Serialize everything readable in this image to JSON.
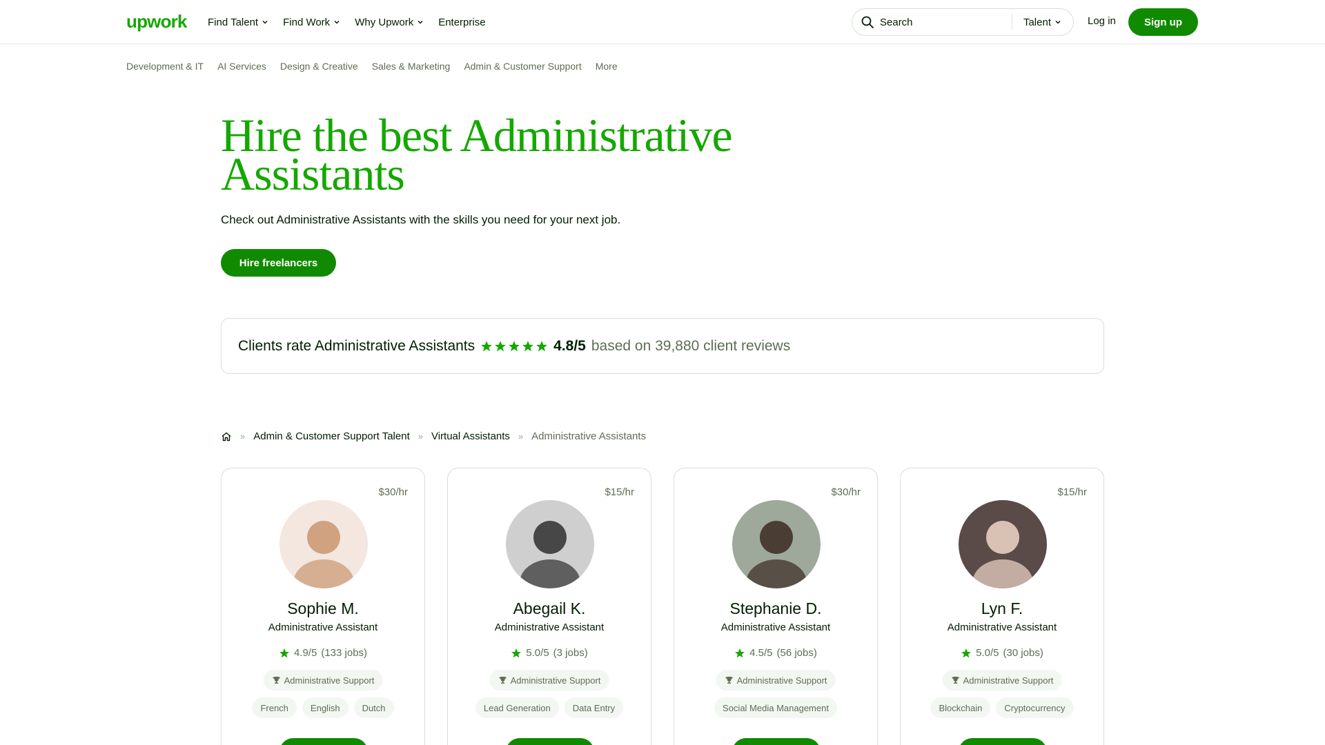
{
  "header": {
    "logo": "upwork",
    "nav": [
      {
        "label": "Find Talent",
        "dropdown": true
      },
      {
        "label": "Find Work",
        "dropdown": true
      },
      {
        "label": "Why Upwork",
        "dropdown": true
      },
      {
        "label": "Enterprise",
        "dropdown": false
      }
    ],
    "search": {
      "placeholder": "Search",
      "scope": "Talent"
    },
    "login": "Log in",
    "signup": "Sign up"
  },
  "subnav": [
    "Development & IT",
    "AI Services",
    "Design & Creative",
    "Sales & Marketing",
    "Admin & Customer Support",
    "More"
  ],
  "hero": {
    "title_line1": "Hire the best Administrative",
    "title_line2": "Assistants",
    "subtitle": "Check out Administrative Assistants with the skills you need for your next job.",
    "cta": "Hire freelancers"
  },
  "rating": {
    "label": "Clients rate Administrative Assistants",
    "stars": 5,
    "score": "4.8/5",
    "based_on": "based on 39,880 client reviews"
  },
  "breadcrumb": {
    "items": [
      "Admin & Customer Support Talent",
      "Virtual Assistants"
    ],
    "current": "Administrative Assistants"
  },
  "colors": {
    "brand_green": "#14a800",
    "button_green": "#108a00",
    "text_dark": "#001e00",
    "text_muted": "#5e6d55"
  },
  "freelancers": [
    {
      "rate": "$30/hr",
      "name": "Sophie M.",
      "role": "Administrative Assistant",
      "rating": "4.9/5",
      "jobs": "(133 jobs)",
      "badge": "Administrative Support",
      "skills": [
        "French",
        "English",
        "Dutch"
      ],
      "avatar_colors": [
        "#f3e7df",
        "#c9956f"
      ]
    },
    {
      "rate": "$15/hr",
      "name": "Abegail K.",
      "role": "Administrative Assistant",
      "rating": "5.0/5",
      "jobs": "(3 jobs)",
      "badge": "Administrative Support",
      "skills": [
        "Lead Generation",
        "Data Entry"
      ],
      "avatar_colors": [
        "#cfcfcf",
        "#2f2f2f"
      ]
    },
    {
      "rate": "$30/hr",
      "name": "Stephanie D.",
      "role": "Administrative Assistant",
      "rating": "4.5/5",
      "jobs": "(56 jobs)",
      "badge": "Administrative Support",
      "skills": [
        "Social Media Management"
      ],
      "avatar_colors": [
        "#9ea99c",
        "#3b2a22"
      ]
    },
    {
      "rate": "$15/hr",
      "name": "Lyn F.",
      "role": "Administrative Assistant",
      "rating": "5.0/5",
      "jobs": "(30 jobs)",
      "badge": "Administrative Support",
      "skills": [
        "Blockchain",
        "Cryptocurrency"
      ],
      "avatar_colors": [
        "#5a4a48",
        "#f0d6c8"
      ]
    }
  ]
}
